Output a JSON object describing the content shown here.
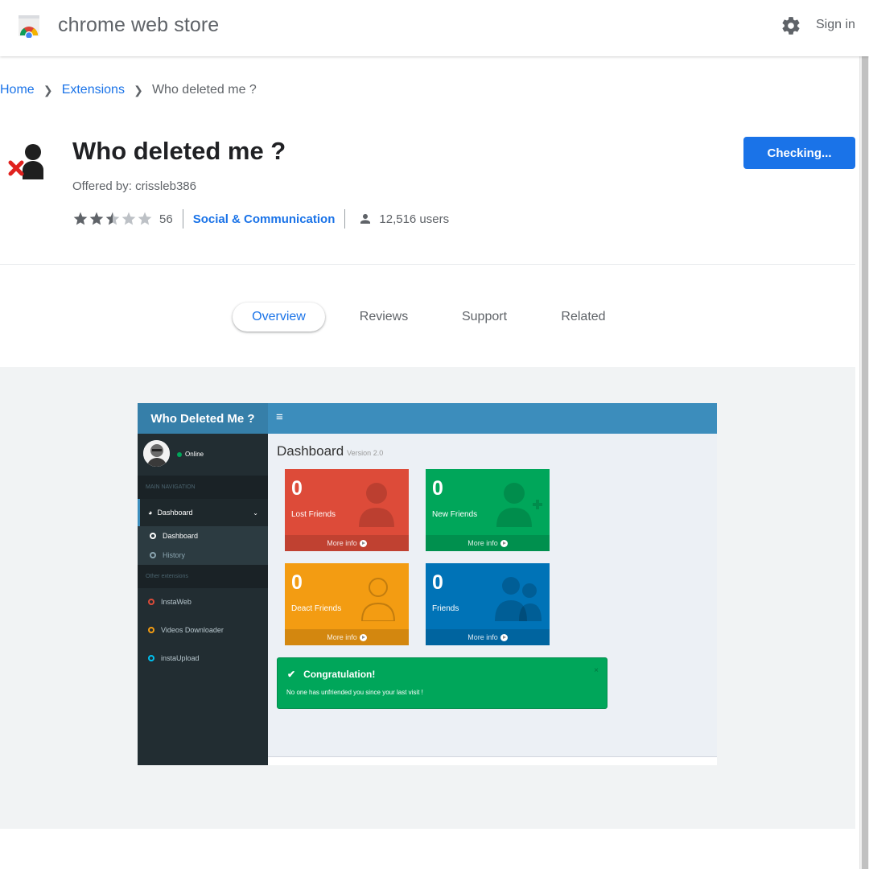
{
  "topbar": {
    "store_title": "chrome web store",
    "settings_icon": "gear-icon",
    "sign_in": "Sign in"
  },
  "breadcrumb": {
    "home": "Home",
    "extensions": "Extensions",
    "current": "Who deleted me ?"
  },
  "extension": {
    "title": "Who deleted me ?",
    "offered_by": "Offered by: crissleb386",
    "rating": 2.5,
    "rating_count": "56",
    "category": "Social & Communication",
    "users": "12,516 users",
    "cta_label": "Checking..."
  },
  "tabs": [
    {
      "label": "Overview",
      "active": true
    },
    {
      "label": "Reviews",
      "active": false
    },
    {
      "label": "Support",
      "active": false
    },
    {
      "label": "Related",
      "active": false
    }
  ],
  "screenshot": {
    "app_title": "Who Deleted Me ?",
    "menu_glyph": "≡",
    "status": "Online",
    "main_nav_header": "MAIN NAVIGATION",
    "nav_dashboard": "Dashboard",
    "sub_dashboard": "Dashboard",
    "sub_history": "History",
    "other_header": "Other extensions",
    "ext1": "InstaWeb",
    "ext2": "Videos Downloader",
    "ext3": "instaUpload",
    "page_title": "Dashboard",
    "page_version": "Version 2.0",
    "boxes": [
      {
        "value": "0",
        "label": "Lost Friends",
        "more": "More info",
        "color": "#dd4b39"
      },
      {
        "value": "0",
        "label": "New Friends",
        "more": "More info",
        "color": "#00a65a"
      },
      {
        "value": "0",
        "label": "Deact Friends",
        "more": "More info",
        "color": "#f39c12"
      },
      {
        "value": "0",
        "label": "Friends",
        "more": "More info",
        "color": "#0073b7"
      }
    ],
    "alert_title": "Congratulation!",
    "alert_text": "No one has unfriended you since your last visit !",
    "alert_close": "×"
  },
  "colors": {
    "accent": "#1a73e8",
    "app_header": "#3c8dbc",
    "sidebar": "#222d32"
  }
}
